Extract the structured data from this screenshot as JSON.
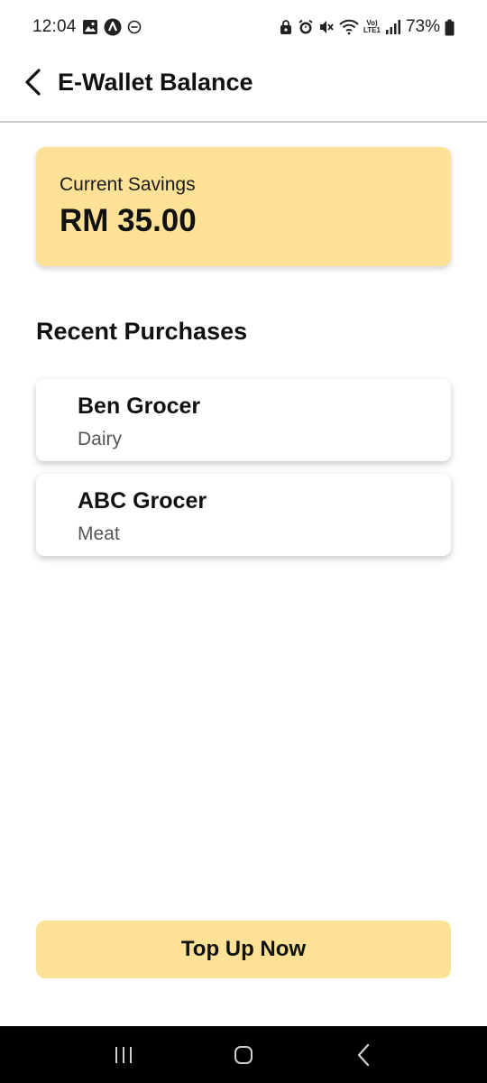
{
  "status_bar": {
    "time": "12:04",
    "battery_percent": "73%",
    "volte_top": "Vo)",
    "volte_bottom": "LTE1",
    "icons_left": [
      "gallery-icon",
      "app-a-icon",
      "dnd-icon"
    ],
    "icons_right": [
      "lock-icon",
      "alarm-icon",
      "mute-icon",
      "wifi-icon",
      "signal-icon",
      "battery-icon"
    ]
  },
  "header": {
    "title": "E-Wallet Balance",
    "back_icon": "chevron-left-icon"
  },
  "savings": {
    "label": "Current Savings",
    "amount": "RM 35.00"
  },
  "recent": {
    "title": "Recent Purchases",
    "items": [
      {
        "name": "Ben Grocer",
        "category": "Dairy"
      },
      {
        "name": "ABC Grocer",
        "category": "Meat"
      }
    ]
  },
  "actions": {
    "topup_label": "Top Up Now"
  },
  "colors": {
    "accent": "#fde197",
    "divider": "#c9c9c9",
    "nav_bg": "#000000"
  },
  "nav": {
    "icons": [
      "recent-apps-icon",
      "home-icon",
      "back-icon"
    ]
  }
}
